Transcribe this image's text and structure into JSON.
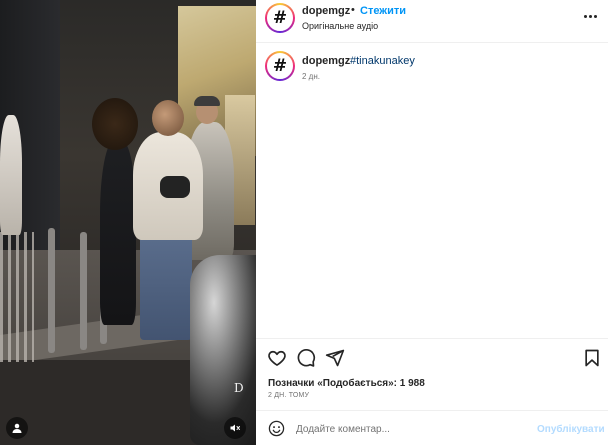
{
  "post": {
    "username": "dopemgz",
    "separator": "•",
    "follow_label": "Стежити",
    "audio_label": "Оригінальне аудіо",
    "avatar_symbol": "#"
  },
  "caption": {
    "username": "dopemgz",
    "hashtag": "#tinakunakey",
    "age": "2 дн."
  },
  "engagement": {
    "likes_label": "Позначки «Подобається»: 1 988",
    "time_ago": "2 ДН. ТОМУ"
  },
  "comment": {
    "placeholder": "Додайте коментар...",
    "publish_label": "Опублікувати"
  },
  "media": {
    "watermark": "D"
  },
  "icons": {
    "more": "more-horizontal-icon",
    "like": "heart-icon",
    "comment": "comment-icon",
    "share": "send-icon",
    "save": "bookmark-icon",
    "emoji": "emoji-icon",
    "user_tag": "user-tag-icon",
    "mute": "mute-icon"
  },
  "colors": {
    "link": "#0095f6",
    "hashtag": "#00376b",
    "publish_disabled": "#b3dbff"
  }
}
